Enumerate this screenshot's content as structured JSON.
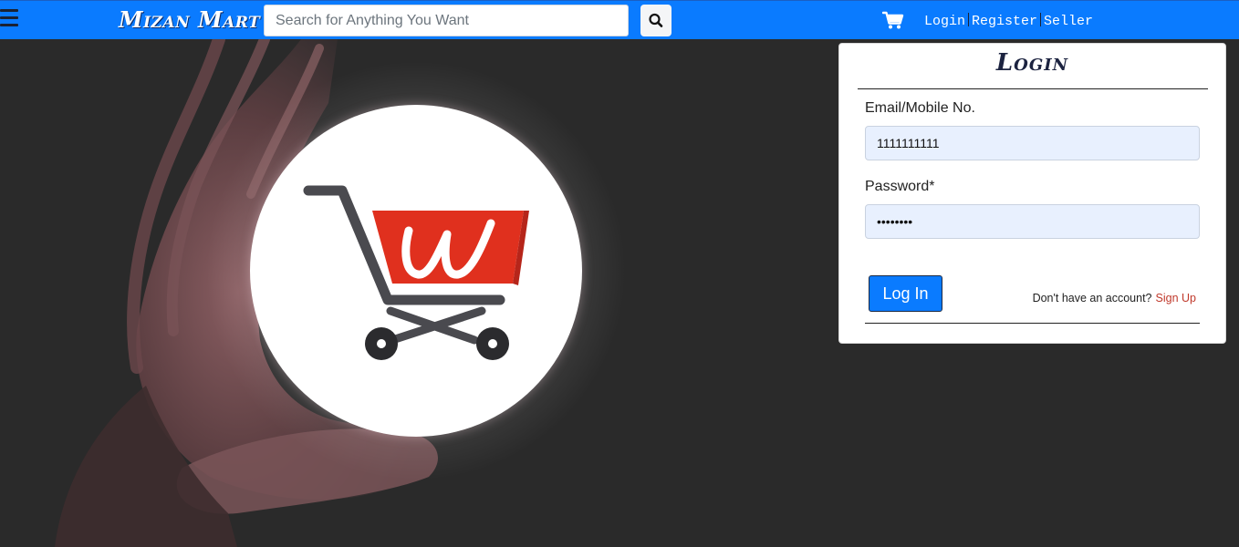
{
  "header": {
    "brand": "Mizan Mart",
    "search_placeholder": "Search for Anything You Want",
    "nav_links": [
      "Login",
      "Register",
      "Seller"
    ],
    "icons": [
      "menu-icon",
      "search-icon",
      "cart-icon"
    ]
  },
  "hero": {
    "logo_letter": "w",
    "colors": {
      "cart_body": "#e0301e",
      "cart_frame": "#4a4a4f"
    }
  },
  "login": {
    "title": "Login",
    "email_label": "Email/Mobile No.",
    "email_value": "1111111111",
    "password_label": "Password*",
    "password_value": "••••••••",
    "submit_label": "Log In",
    "signup_prompt": "Don't have an account?",
    "signup_link": "Sign Up"
  },
  "colors": {
    "accent": "#0a7bff",
    "link_red": "#c0392b",
    "input_bg": "#e8f0fe",
    "background": "#2a2a2a"
  }
}
